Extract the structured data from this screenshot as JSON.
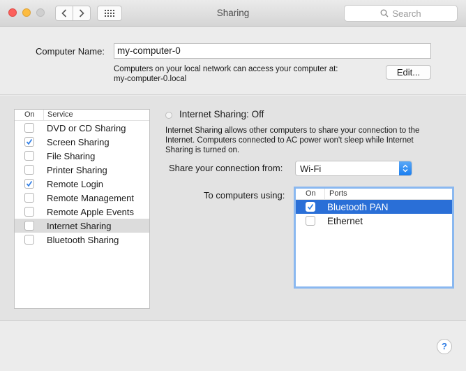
{
  "window": {
    "title": "Sharing"
  },
  "toolbar": {
    "back_icon": "chevron-left-icon",
    "forward_icon": "chevron-right-icon",
    "grid_icon": "show-all-grid-icon",
    "search_placeholder": "Search"
  },
  "computer_name": {
    "label": "Computer Name:",
    "value": "my-computer-0",
    "note_line1": "Computers on your local network can access your computer at:",
    "note_line2": "my-computer-0.local",
    "edit_label": "Edit..."
  },
  "services": {
    "header_on": "On",
    "header_service": "Service",
    "items": [
      {
        "label": "DVD or CD Sharing",
        "checked": false,
        "selected": false
      },
      {
        "label": "Screen Sharing",
        "checked": true,
        "selected": false
      },
      {
        "label": "File Sharing",
        "checked": false,
        "selected": false
      },
      {
        "label": "Printer Sharing",
        "checked": false,
        "selected": false
      },
      {
        "label": "Remote Login",
        "checked": true,
        "selected": false
      },
      {
        "label": "Remote Management",
        "checked": false,
        "selected": false
      },
      {
        "label": "Remote Apple Events",
        "checked": false,
        "selected": false
      },
      {
        "label": "Internet Sharing",
        "checked": false,
        "selected": true
      },
      {
        "label": "Bluetooth Sharing",
        "checked": false,
        "selected": false
      }
    ]
  },
  "detail": {
    "title": "Internet Sharing: Off",
    "description": "Internet Sharing allows other computers to share your connection to the Internet. Computers connected to AC power won't sleep while Internet Sharing is turned on.",
    "share_from_label": "Share your connection from:",
    "share_from_value": "Wi-Fi",
    "to_computers_label": "To computers using:",
    "ports_header_on": "On",
    "ports_header_ports": "Ports",
    "ports": [
      {
        "label": "Bluetooth PAN",
        "checked": true,
        "selected": true
      },
      {
        "label": "Ethernet",
        "checked": false,
        "selected": false
      }
    ]
  },
  "help": {
    "label": "?"
  },
  "colors": {
    "accent": "#2a6fd7",
    "checkmark": "#2a7ae4"
  }
}
